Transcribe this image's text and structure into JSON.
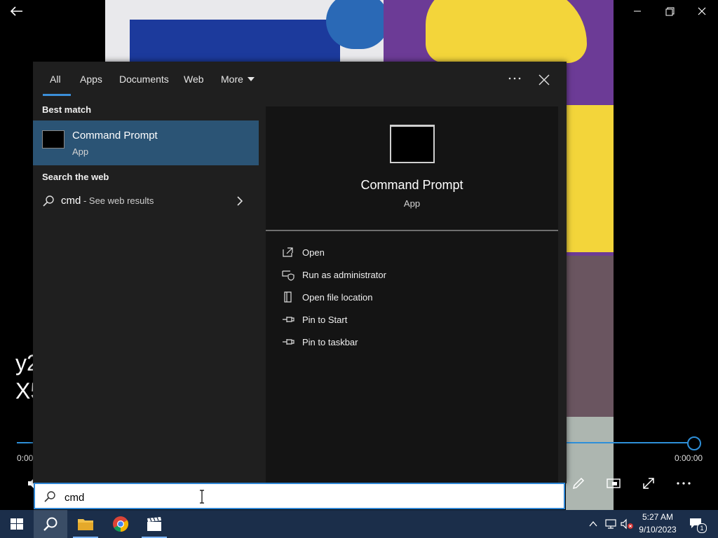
{
  "player": {
    "overlay_line1": "y2",
    "overlay_line2": "X5",
    "time_start": "0:00",
    "time_end": "0:00:00",
    "accent": "#2e8fd8"
  },
  "search": {
    "tabs": [
      {
        "label": "All",
        "active": true
      },
      {
        "label": "Apps"
      },
      {
        "label": "Documents"
      },
      {
        "label": "Web"
      },
      {
        "label": "More"
      }
    ],
    "best_match_label": "Best match",
    "best_match": {
      "title": "Command Prompt",
      "subtitle": "App"
    },
    "search_web_label": "Search the web",
    "web_result": {
      "query": "cmd",
      "suffix": " - See web results"
    },
    "preview": {
      "title": "Command Prompt",
      "subtitle": "App"
    },
    "actions": [
      {
        "label": "Open",
        "icon": "open-icon"
      },
      {
        "label": "Run as administrator",
        "icon": "shield-icon"
      },
      {
        "label": "Open file location",
        "icon": "file-location-icon"
      },
      {
        "label": "Pin to Start",
        "icon": "pin-icon"
      },
      {
        "label": "Pin to taskbar",
        "icon": "pin-icon"
      }
    ],
    "input_value": "cmd",
    "highlight": "#2b5475"
  },
  "taskbar": {
    "time": "5:27 AM",
    "date": "9/10/2023",
    "notification_count": "1",
    "color": "#1b2e4a"
  }
}
